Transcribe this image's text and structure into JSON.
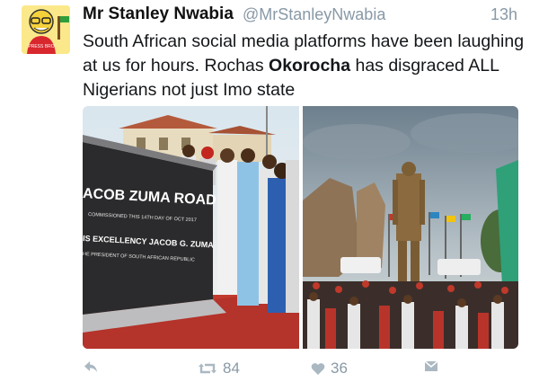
{
  "tweet": {
    "author_name": "Mr Stanley Nwabia",
    "handle": "@MrStanleyNwabia",
    "timestamp": "13h",
    "text_before": "South African social media platforms have been laughing at us for hours. Rochas ",
    "text_bold": "Okorocha",
    "text_after": " has disgraced ALL Nigerians not just Imo state"
  },
  "photo_left": {
    "sign_line1": "ACOB ZUMA ROAD",
    "sign_line2": "COMMISSIONED THIS 14TH DAY OF OCT 2017",
    "sign_line3": "IS EXCELLENCY JACOB G. ZUMA",
    "sign_line4": "HE PRESIDENT OF SOUTH AFRICAN REPUBLIC"
  },
  "avatar": {
    "badge_text": "PRESS BRO"
  },
  "actions": {
    "retweet_count": "84",
    "like_count": "36"
  },
  "icons": {
    "reply": "reply-icon",
    "retweet": "retweet-icon",
    "like": "heart-icon",
    "dm": "direct-message-icon"
  },
  "colors": {
    "muted": "#8899a6",
    "icon": "#aab8c2"
  }
}
